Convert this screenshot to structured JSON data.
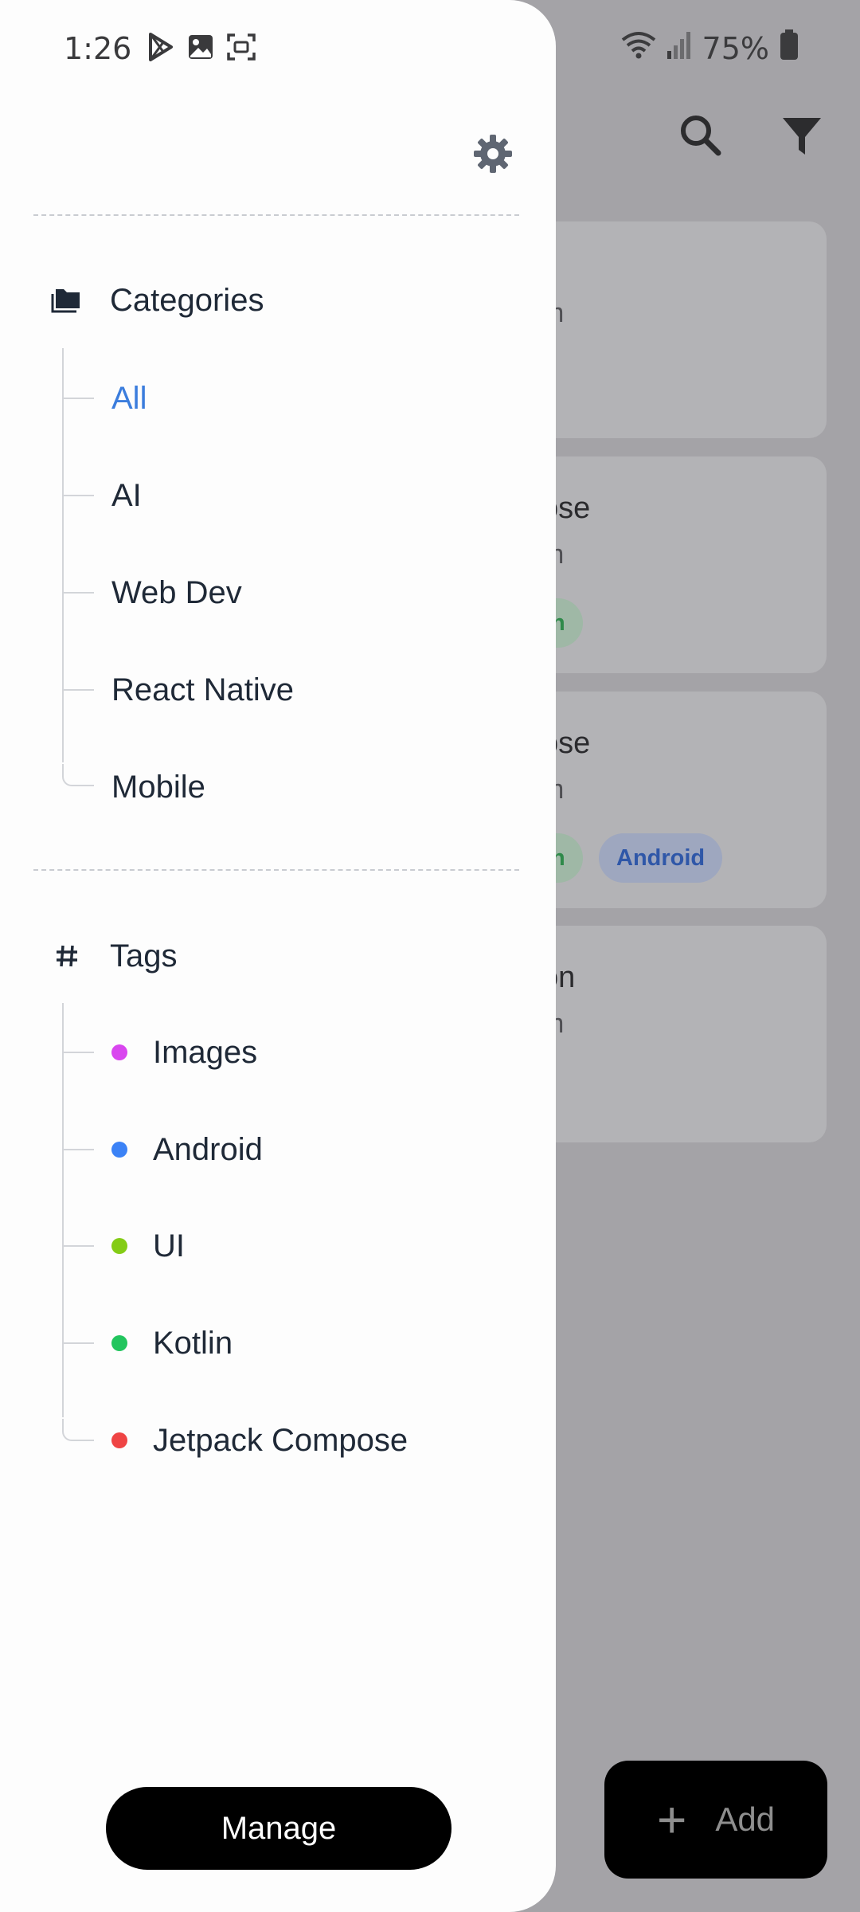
{
  "status_bar": {
    "time": "1:26",
    "battery": "75%"
  },
  "background": {
    "cards": [
      {
        "title": "",
        "subtitle": "m",
        "chips": []
      },
      {
        "title": "ose",
        "subtitle": "m",
        "chips": [
          {
            "label": "in",
            "tone": "green"
          }
        ]
      },
      {
        "title": "ose",
        "subtitle": "m",
        "chips": [
          {
            "label": "in",
            "tone": "green"
          },
          {
            "label": "Android",
            "tone": "blue"
          }
        ]
      },
      {
        "title": "on",
        "subtitle": "m",
        "chips": []
      }
    ],
    "fab_label": "Add"
  },
  "drawer": {
    "categories_heading": "Categories",
    "categories": [
      {
        "label": "All",
        "active": true
      },
      {
        "label": "AI",
        "active": false
      },
      {
        "label": "Web Dev",
        "active": false
      },
      {
        "label": "React Native",
        "active": false
      },
      {
        "label": "Mobile",
        "active": false
      }
    ],
    "tags_heading": "Tags",
    "tags": [
      {
        "label": "Images",
        "color": "#d946ef"
      },
      {
        "label": "Android",
        "color": "#3b82f6"
      },
      {
        "label": "UI",
        "color": "#84cc16"
      },
      {
        "label": "Kotlin",
        "color": "#22c55e"
      },
      {
        "label": "Jetpack Compose",
        "color": "#ef4444"
      }
    ],
    "manage_label": "Manage"
  },
  "colors": {
    "accent": "#3b7ddd",
    "scrim": "#a4a3a7"
  }
}
